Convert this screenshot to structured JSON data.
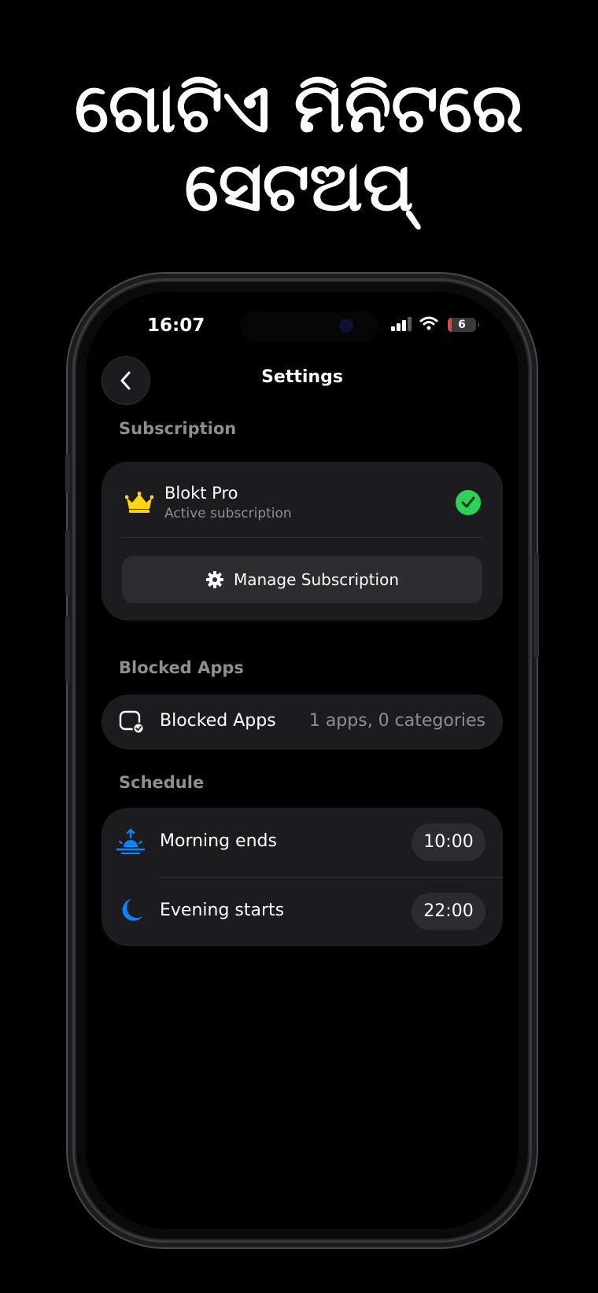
{
  "headline": {
    "line1": "ଗୋଟିଏ ମିନିଟରେ",
    "line2": "ସେଟଅପ୍"
  },
  "status_bar": {
    "time": "16:07",
    "battery": "6"
  },
  "nav": {
    "title": "Settings",
    "back_icon": "chevron-left-icon"
  },
  "subscription": {
    "section_label": "Subscription",
    "plan_name": "Blokt Pro",
    "plan_status": "Active subscription",
    "manage_label": "Manage Subscription",
    "crown_color": "#FFD60A",
    "check_color": "#30D158"
  },
  "blocked_apps": {
    "section_label": "Blocked Apps",
    "row_label": "Blocked Apps",
    "row_value": "1 apps, 0 categories"
  },
  "schedule": {
    "section_label": "Schedule",
    "rows": [
      {
        "label": "Morning ends",
        "time": "10:00",
        "icon": "sunrise-icon"
      },
      {
        "label": "Evening starts",
        "time": "22:00",
        "icon": "moon-icon"
      }
    ],
    "accent_color": "#0A84FF"
  }
}
